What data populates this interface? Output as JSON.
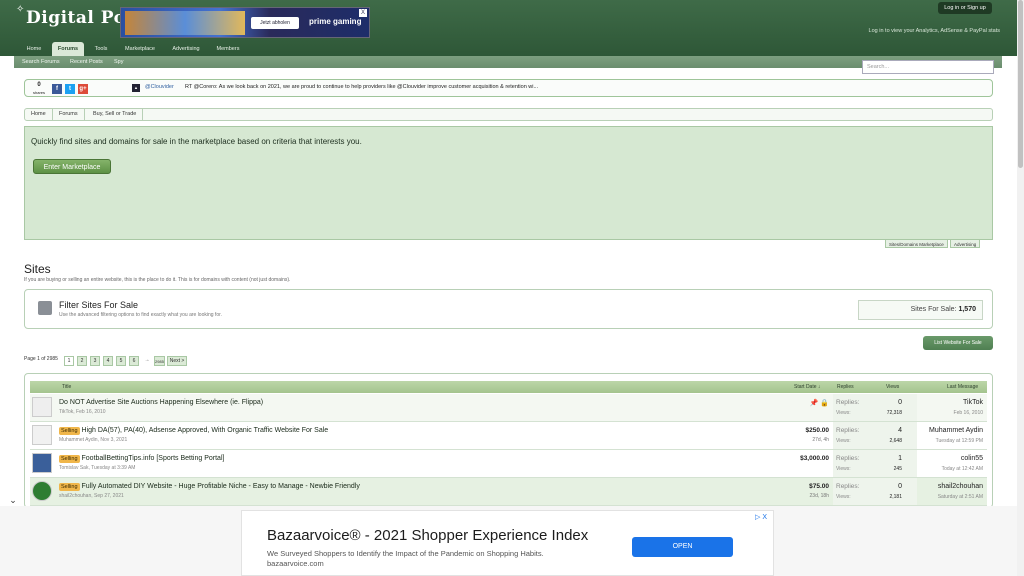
{
  "header": {
    "logo_text": "Digital Point",
    "login_label": "Log in or Sign up",
    "login_note": "Log in to view your Analytics, AdSense & PayPal stats",
    "top_ad": {
      "cta": "Jetzt abholen",
      "brand": "prime gaming",
      "close": "X"
    }
  },
  "nav": {
    "tabs": [
      {
        "label": "Home"
      },
      {
        "label": "Forums"
      },
      {
        "label": "Tools"
      },
      {
        "label": "Marketplace"
      },
      {
        "label": "Advertising"
      },
      {
        "label": "Members"
      }
    ],
    "subnav": [
      {
        "label": "Search Forums"
      },
      {
        "label": "Recent Posts"
      },
      {
        "label": "Spy"
      }
    ],
    "search_placeholder": "Search..."
  },
  "social": {
    "share_count": "0",
    "share_label": "shares",
    "buttons": [
      "f",
      "t",
      "g+"
    ],
    "twitter_handle": "@Clouvider",
    "tweet": "RT @Corero: As we look back on 2021, we are proud to continue to help providers like @Clouvider improve customer acquisition & retention wi..."
  },
  "breadcrumb": [
    "Home",
    "Forums",
    "Buy, Sell or Trade"
  ],
  "promo": {
    "text": "Quickly find sites and domains for sale in the marketplace based on criteria that interests you.",
    "button": "Enter Marketplace",
    "tabs": [
      "Sites/Domains Marketplace",
      "Advertising"
    ]
  },
  "section": {
    "title": "Sites",
    "description": "If you are buying or selling an entire website, this is the place to do it. This is for domains with content (not just domains).",
    "filter_title": "Filter Sites For Sale",
    "filter_desc": "Use the advanced filtering options to find exactly what you are looking for.",
    "sites_for_sale_label": "Sites For Sale:",
    "sites_for_sale_count": "1,570",
    "list_button": "List Website For Sale"
  },
  "pager": {
    "label": "Page 1 of 2985",
    "pages": [
      "1",
      "2",
      "3",
      "4",
      "5",
      "6"
    ],
    "arrow": "→",
    "last": "2985",
    "next": "Next >"
  },
  "table": {
    "headers": {
      "title": "Title",
      "start_date": "Start Date ↓",
      "replies": "Replies",
      "views": "Views",
      "last_message": "Last Message"
    },
    "reply_label": "Replies:",
    "view_label": "Views:",
    "rows": [
      {
        "badge": "",
        "title": "Do NOT Advertise Site Auctions Happening Elsewhere (ie. Flippa)",
        "author": "TikTok,",
        "date": "Feb 16, 2010",
        "price": "",
        "age": "",
        "replies": "0",
        "views": "72,318",
        "last_user": "TikTok",
        "last_date": "Feb 16, 2010",
        "pins": "📌 🔒"
      },
      {
        "badge": "Selling",
        "title": "High DA(57), PA(40), Adsense Approved, With Organic Traffic Website For Sale",
        "author": "Muhammet Aydin,",
        "date": "Nov 3, 2021",
        "price": "$250.00",
        "age": "27d, 4h",
        "replies": "4",
        "views": "2,648",
        "last_user": "Muhammet Aydin",
        "last_date": "Tuesday at 12:59 PM",
        "pins": ""
      },
      {
        "badge": "Selling",
        "title": "FootballBettingTips.info [Sports Betting Portal]",
        "author": "Tomislav Sak,",
        "date": "Tuesday at 3:39 AM",
        "price": "$3,000.00",
        "age": "",
        "replies": "1",
        "views": "245",
        "last_user": "colin55",
        "last_date": "Today at 12:42 AM",
        "pins": ""
      },
      {
        "badge": "Selling",
        "title": "Fully Automated DIY Website - Huge Profitable Niche - Easy to Manage - Newbie Friendly",
        "author": "shail2chouhan,",
        "date": "Sep 27, 2021",
        "price": "$75.00",
        "age": "23d, 18h",
        "replies": "0",
        "views": "2,181",
        "last_user": "shail2chouhan",
        "last_date": "Saturday at 2:51 AM",
        "pins": ""
      }
    ]
  },
  "bottom_ad": {
    "title": "Bazaarvoice® - 2021 Shopper Experience Index",
    "desc": "We Surveyed Shoppers to Identify the Impact of the Pandemic on Shopping Habits.",
    "url": "bazaarvoice.com",
    "cta": "OPEN",
    "close": "▷ X"
  },
  "colors": {
    "header_green": "#3f6b48",
    "accent_green": "#5d9145",
    "badge_orange": "#f0b64a",
    "ad_blue": "#1a73e8"
  }
}
